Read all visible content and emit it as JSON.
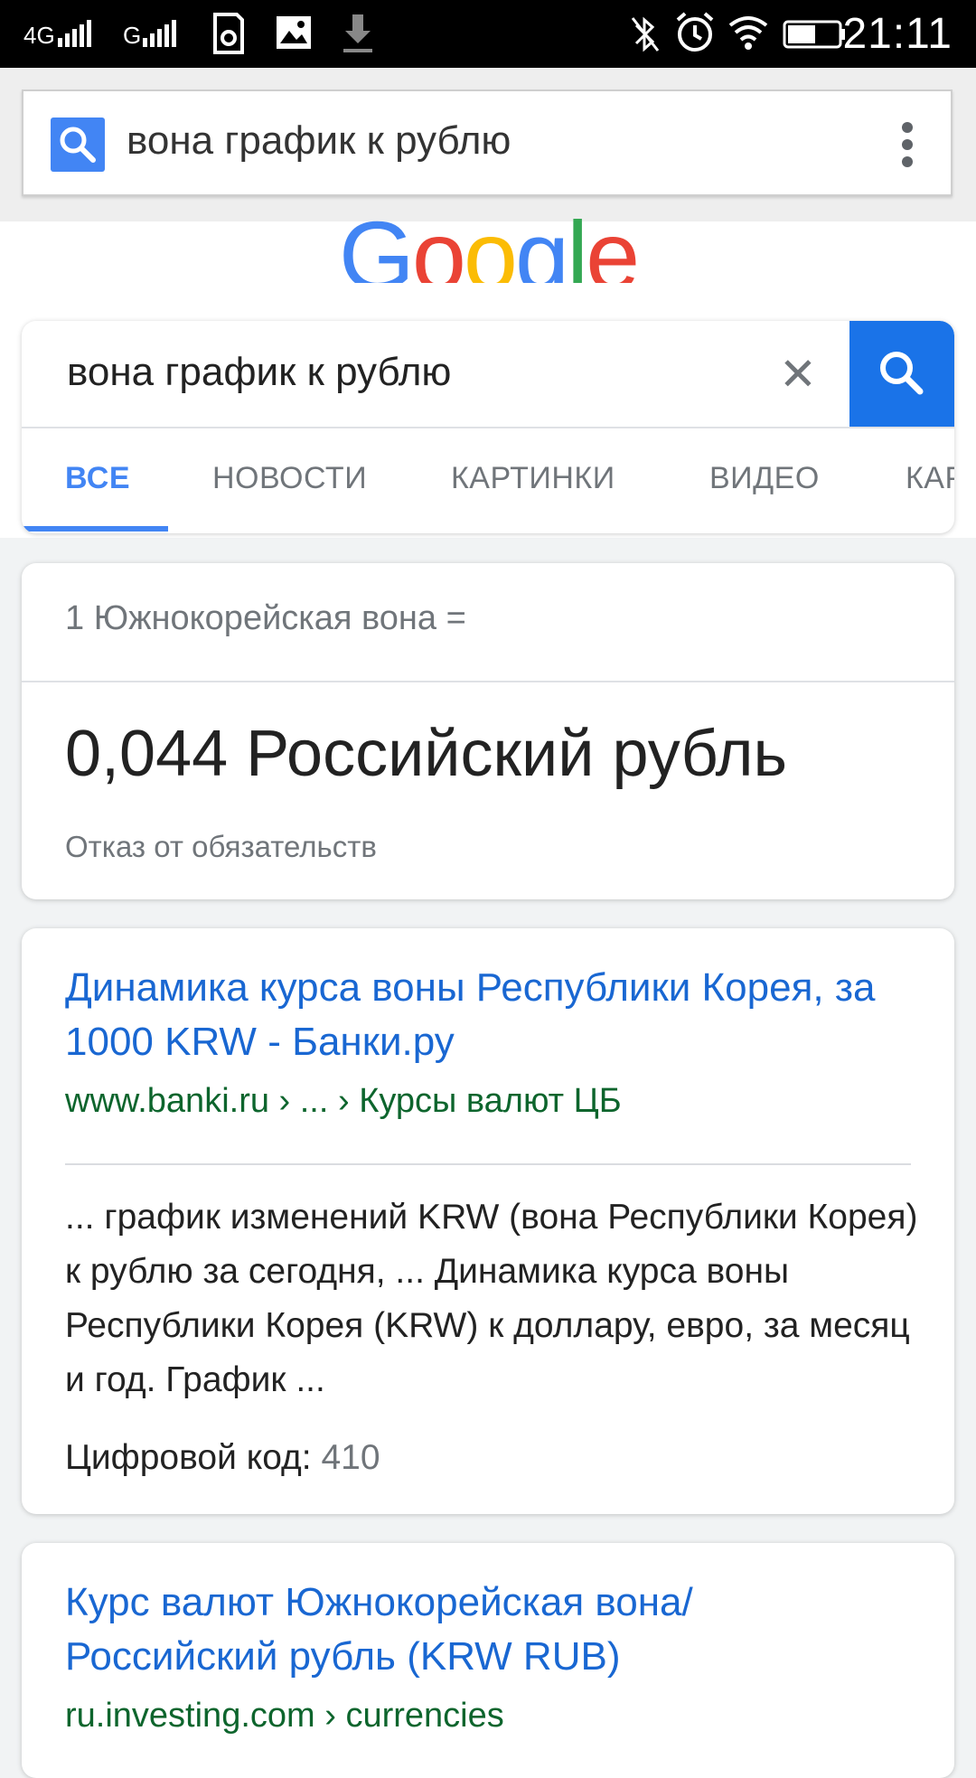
{
  "status_bar": {
    "network1": "4G",
    "network2": "G",
    "time": "21:11"
  },
  "omnibox": {
    "query": "вона график к рублю"
  },
  "google": {
    "logo_letters": [
      "G",
      "o",
      "o",
      "g",
      "l",
      "e"
    ],
    "logo_colors": [
      "#4285f4",
      "#ea4335",
      "#fbbc05",
      "#4285f4",
      "#34a853",
      "#ea4335"
    ]
  },
  "search": {
    "query": "вона график к рублю",
    "tabs": [
      "ВСЕ",
      "НОВОСТИ",
      "КАРТИНКИ",
      "ВИДЕО",
      "КАРТЫ"
    ]
  },
  "converter": {
    "from_text": "1 Южнокорейская вона =",
    "to_text": "0,044 Российский рубль",
    "disclaimer": "Отказ от обязательств"
  },
  "results": [
    {
      "title": "Динамика курса воны Республики Корея, за 1000 KRW - Банки.ру",
      "url": "www.banki.ru › ... › Курсы валют ЦБ",
      "snippet": "... график изменений KRW (вона Республики Корея) к рублю за сегодня, ... Динамика курса воны Республики Корея (KRW) к доллару, евро, за месяц и год. График ...",
      "meta_label": "Цифровой код:",
      "meta_value": "410"
    },
    {
      "title": "Курс валют Южнокорейская вона/ Российский рубль (KRW RUB)",
      "url": "ru.investing.com › currencies"
    }
  ],
  "colors": {
    "accent": "#4285f4",
    "search_button": "#1a73e8",
    "link": "#1967d2",
    "url_green": "#0d652d"
  }
}
